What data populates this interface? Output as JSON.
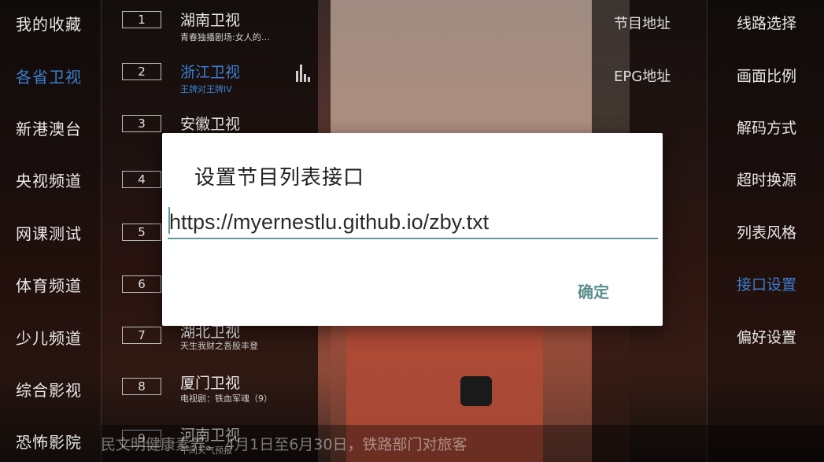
{
  "categories": [
    {
      "label": "我的收藏",
      "active": false
    },
    {
      "label": "各省卫视",
      "active": true
    },
    {
      "label": "新港澳台",
      "active": false
    },
    {
      "label": "央视频道",
      "active": false
    },
    {
      "label": "网课测试",
      "active": false
    },
    {
      "label": "体育频道",
      "active": false
    },
    {
      "label": "少儿频道",
      "active": false
    },
    {
      "label": "综合影视",
      "active": false
    },
    {
      "label": "恐怖影院",
      "active": false
    }
  ],
  "channels": [
    {
      "num": "1",
      "name": "湖南卫视",
      "program": "青春独播剧场:女人的…"
    },
    {
      "num": "2",
      "name": "浙江卫视",
      "program": "王牌对王牌IV"
    },
    {
      "num": "3",
      "name": "安徽卫视",
      "program": ""
    },
    {
      "num": "4",
      "name": "",
      "program": ""
    },
    {
      "num": "5",
      "name": "",
      "program": ""
    },
    {
      "num": "6",
      "name": "",
      "program": ""
    },
    {
      "num": "7",
      "name": "湖北卫视",
      "program": "天生我财之吾股丰登"
    },
    {
      "num": "8",
      "name": "厦门卫视",
      "program": "电视剧：铁血军魂（9）"
    },
    {
      "num": "9",
      "name": "河南卫视",
      "program": "午间天气预报"
    }
  ],
  "epg_menu": [
    "节目地址",
    "EPG地址"
  ],
  "settings": [
    {
      "label": "线路选择",
      "active": false
    },
    {
      "label": "画面比例",
      "active": false
    },
    {
      "label": "解码方式",
      "active": false
    },
    {
      "label": "超时换源",
      "active": false
    },
    {
      "label": "列表风格",
      "active": false
    },
    {
      "label": "接口设置",
      "active": true
    },
    {
      "label": "偏好设置",
      "active": false
    }
  ],
  "dialog": {
    "title": "设置节目列表接口",
    "input_value": "https://myernestlu.github.io/zby.txt",
    "ok_label": "确定"
  },
  "ticker": "民文明健康素养。    4月1日至6月30日，铁路部门对旅客",
  "colors": {
    "active": "#3b7fd0",
    "accent": "#5f9c96"
  }
}
